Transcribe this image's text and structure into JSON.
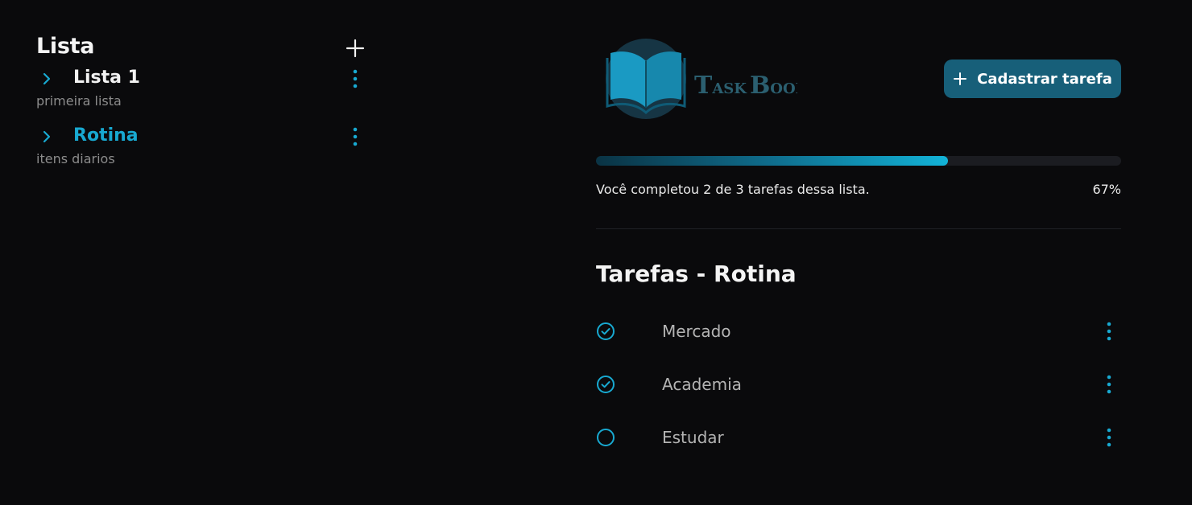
{
  "colors": {
    "background": "#0a0a0c",
    "accent": "#18a9d1",
    "button_bg": "#175f79",
    "muted_text": "#8c8c8c"
  },
  "sidebar": {
    "title": "Lista",
    "add_icon": "plus-icon",
    "items": [
      {
        "name": "Lista 1",
        "description": "primeira lista",
        "active": false,
        "icon": "chevron-right-icon",
        "menu_icon": "kebab-icon"
      },
      {
        "name": "Rotina",
        "description": "itens diarios",
        "active": true,
        "icon": "chevron-right-icon",
        "menu_icon": "kebab-icon"
      }
    ]
  },
  "header": {
    "logo": {
      "text_big1": "T",
      "text_small1": "ASK",
      "text_big2": "B",
      "text_small2": "OOK",
      "icon": "open-book-icon"
    },
    "add_task_label": "Cadastrar tarefa",
    "add_task_icon": "plus-icon"
  },
  "progress": {
    "percent_value": 67,
    "text": "Você completou 2 de 3 tarefas dessa lista.",
    "percent_label": "67%"
  },
  "tasks": {
    "title": "Tarefas - Rotina",
    "items": [
      {
        "label": "Mercado",
        "done": true,
        "icon": "check-circle-icon"
      },
      {
        "label": "Academia",
        "done": true,
        "icon": "check-circle-icon"
      },
      {
        "label": "Estudar",
        "done": false,
        "icon": "empty-circle-icon"
      }
    ]
  }
}
